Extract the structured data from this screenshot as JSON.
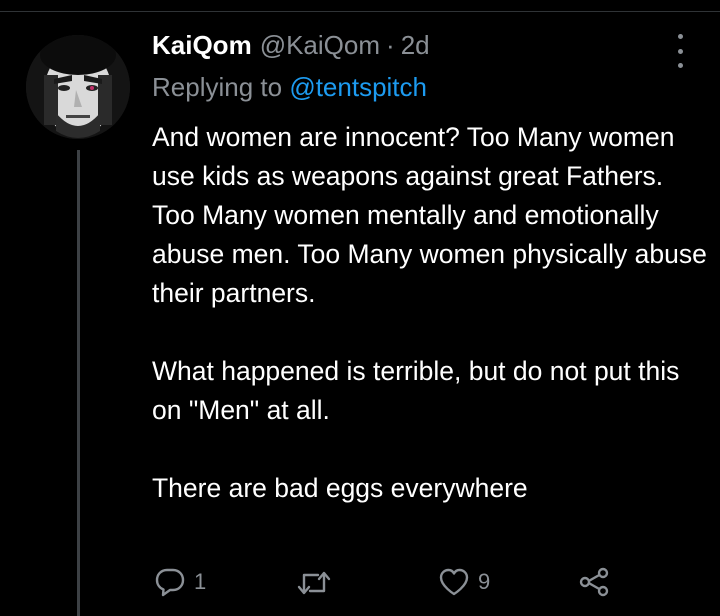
{
  "tweet": {
    "author": {
      "display_name": "KaiQom",
      "handle": "@KaiQom",
      "separator": "·",
      "time_ago": "2d"
    },
    "reply_context": {
      "prefix": "Replying to",
      "mention": "@tentspitch"
    },
    "body": {
      "paragraph_1": "And women are innocent? Too Many women use kids as weapons against great Fathers. Too Many women mentally and emotionally abuse men. Too Many women physically abuse their partners.",
      "paragraph_2": "What happened is terrible, but do not put this on \"Men\" at all.",
      "paragraph_3": "There are bad eggs everywhere"
    },
    "actions": {
      "reply_icon": "speech-bubble-icon",
      "reply_count": "1",
      "retweet_icon": "retweet-arrows-icon",
      "retweet_count": "",
      "like_icon": "heart-outline-icon",
      "like_count": "9",
      "share_icon": "share-nodes-icon"
    },
    "more_icon": "vertical-ellipsis-icon"
  },
  "colors": {
    "background": "#000000",
    "primary_text": "#ffffff",
    "secondary_text": "#8b9096",
    "link": "#1d9bf0",
    "thread_line": "#3d4145"
  }
}
